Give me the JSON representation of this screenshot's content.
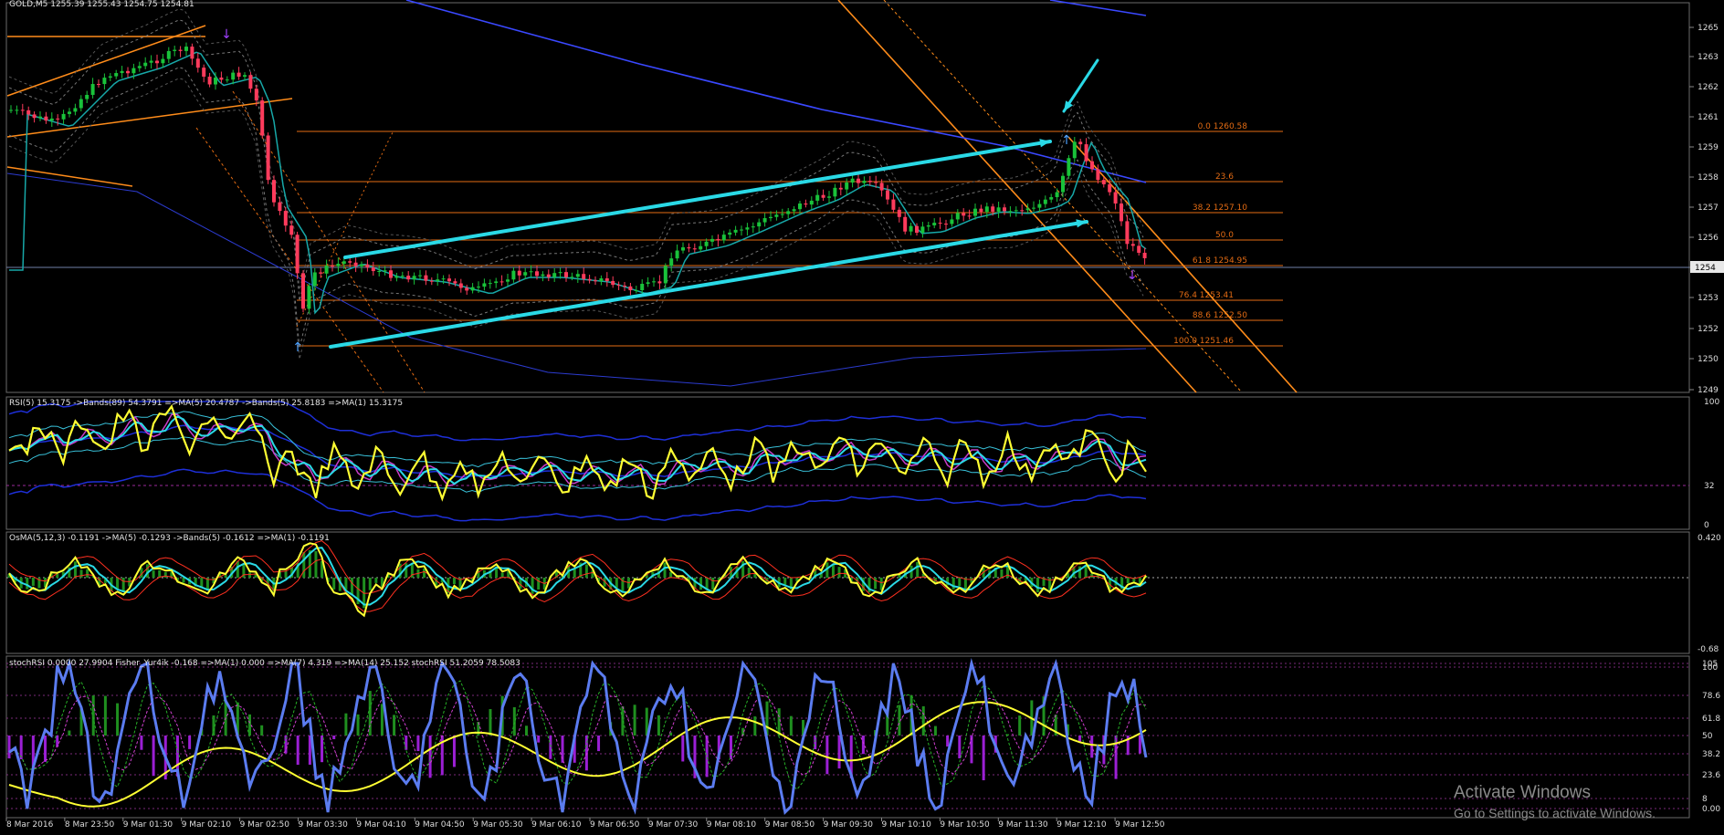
{
  "main": {
    "title": "GOLD,M5  1255.39 1255.43 1254.75 1254.81",
    "price_axis": [
      "1265",
      "1263",
      "1262",
      "1261",
      "1259",
      "1258",
      "1257",
      "1256",
      "1254",
      "1253",
      "1252",
      "1250",
      "1249"
    ],
    "current_price": "1254",
    "fib_levels": [
      {
        "label": "0.0 1260.58"
      },
      {
        "label": "23.6"
      },
      {
        "label": "38.2 1257.10"
      },
      {
        "label": "50.0"
      },
      {
        "label": "61.8 1254.95"
      },
      {
        "label": "76.4 1253.41"
      },
      {
        "label": "88.6 1252.50"
      },
      {
        "label": "100.0 1251.46"
      }
    ]
  },
  "rsi": {
    "title": "RSI(5) 15.3175  ->Bands(89) 54.3791  =>MA(5) 20.4787  ->Bands(5) 25.8183  =>MA(1) 15.3175",
    "axis": [
      "100",
      "32",
      "0"
    ]
  },
  "osma": {
    "title": "OsMA(5,12,3) -0.1191  ->MA(5) -0.1293  ->Bands(5) -0.1612  =>MA(1) -0.1191",
    "axis": [
      "0.420",
      "-0.68"
    ]
  },
  "stoch": {
    "title": "stochRSI 0.0000 27.9904  Fisher_Yur4ik -0.168  =>MA(1) 0.000  =>MA(7) 4.319  =>MA(14) 25.152  stochRSI 51.2059 78.5083",
    "axis": [
      "105",
      "100",
      "78.6",
      "61.8",
      "50",
      "38.2",
      "23.6",
      "8",
      "0.00"
    ]
  },
  "time_axis": [
    "8 Mar 2016",
    "8 Mar 23:50",
    "9 Mar 01:30",
    "9 Mar 02:10",
    "9 Mar 02:50",
    "9 Mar 03:30",
    "9 Mar 04:10",
    "9 Mar 04:50",
    "9 Mar 05:30",
    "9 Mar 06:10",
    "9 Mar 06:50",
    "9 Mar 07:30",
    "9 Mar 08:10",
    "9 Mar 08:50",
    "9 Mar 09:30",
    "9 Mar 10:10",
    "9 Mar 10:50",
    "9 Mar 11:30",
    "9 Mar 12:10",
    "9 Mar 12:50"
  ],
  "watermark": {
    "title": "Activate Windows",
    "subtitle": "Go to Settings to activate Windows."
  },
  "colors": {
    "bull": "#19c23a",
    "bear": "#ff3b5c",
    "fib": "#e36b13",
    "channel": "#ff8c1a",
    "cyan": "#2ad9e6",
    "blue": "#3a48ff",
    "yellow": "#ffff33",
    "magenta": "#c83cc8",
    "green_hist": "#1f8f1f",
    "purple_hist": "#9b1fd4",
    "stoch_blue": "#5b7cf0"
  }
}
